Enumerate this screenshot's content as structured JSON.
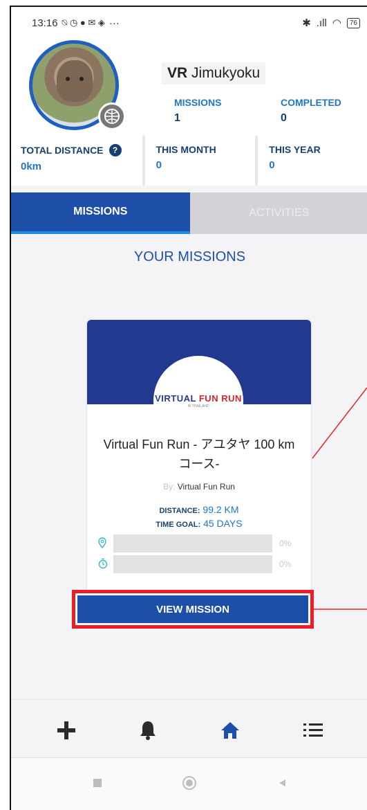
{
  "status_bar": {
    "time": "13:16",
    "icons_left": "⍉ ◷ ● ✉ ◈",
    "more": "···",
    "bluetooth": "✱",
    "signal": ".ıll",
    "wifi": "◠",
    "battery": "76"
  },
  "profile": {
    "name_bold": "VR",
    "name_rest": " Jimukyoku",
    "missions_label": "MISSIONS",
    "missions_value": "1",
    "completed_label": "COMPLETED",
    "completed_value": "0"
  },
  "summary": {
    "total_distance_label": "TOTAL DISTANCE",
    "total_distance_value": "0km",
    "this_month_label": "THIS MONTH",
    "this_month_value": "0",
    "this_year_label": "THIS YEAR",
    "this_year_value": "0"
  },
  "tabs": [
    {
      "label": "MISSIONS",
      "active": true
    },
    {
      "label": "ACTIVITIES",
      "active": false
    }
  ],
  "section_title": "YOUR MISSIONS",
  "mission": {
    "logo_text_a": "VIRTUAL ",
    "logo_text_b": "FUN RUN",
    "logo_sub": "IN THAILAND",
    "title": "Virtual Fun Run - アユタヤ 100 km コース-",
    "by_prefix": "By:",
    "by_name": "Virtual Fun Run",
    "distance_label": "DISTANCE:",
    "distance_value": "99.2 KM",
    "time_goal_label": "TIME GOAL:",
    "time_goal_value": "45 DAYS",
    "distance_progress": "0%",
    "time_progress": "0%",
    "button_label": "VIEW MISSION"
  },
  "bottom_nav": {
    "icons": [
      "plus-icon",
      "bell-icon",
      "home-icon",
      "menu-icon"
    ],
    "active_color": "#1d4fa8"
  },
  "system_nav": {
    "icons": [
      "recents-icon",
      "home-circle-icon",
      "back-icon"
    ]
  },
  "colors": {
    "primary": "#1d4fa8",
    "accent": "#1f76c9",
    "highlight": "#ee1c25"
  }
}
